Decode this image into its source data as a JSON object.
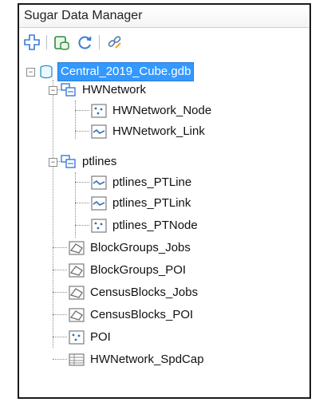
{
  "window": {
    "title": "Sugar Data Manager"
  },
  "toolbar": {
    "buttons": [
      {
        "name": "add-icon"
      },
      {
        "name": "database-icon"
      },
      {
        "name": "refresh-icon"
      },
      {
        "name": "link-icon"
      }
    ]
  },
  "tree": {
    "root": {
      "label": "Central_2019_Cube.gdb",
      "icon": "geodatabase-icon",
      "selected": true
    },
    "items": [
      {
        "label": "HWNetwork",
        "icon": "feature-dataset-icon"
      },
      {
        "label": "HWNetwork_Node",
        "icon": "point-featureclass-icon"
      },
      {
        "label": "HWNetwork_Link",
        "icon": "line-featureclass-icon"
      },
      {
        "label": "ptlines",
        "icon": "feature-dataset-icon"
      },
      {
        "label": "ptlines_PTLine",
        "icon": "line-featureclass-icon"
      },
      {
        "label": "ptlines_PTLink",
        "icon": "line-featureclass-icon"
      },
      {
        "label": "ptlines_PTNode",
        "icon": "point-featureclass-icon"
      },
      {
        "label": "BlockGroups_Jobs",
        "icon": "polygon-featureclass-icon"
      },
      {
        "label": "BlockGroups_POI",
        "icon": "polygon-featureclass-icon"
      },
      {
        "label": "CensusBlocks_Jobs",
        "icon": "polygon-featureclass-icon"
      },
      {
        "label": "CensusBlocks_POI",
        "icon": "polygon-featureclass-icon"
      },
      {
        "label": "POI",
        "icon": "point-featureclass-icon"
      },
      {
        "label": "HWNetwork_SpdCap",
        "icon": "table-icon"
      }
    ]
  },
  "colors": {
    "selection": "#3399ff",
    "dataset": "#3a7bd5",
    "text": "#111111"
  }
}
